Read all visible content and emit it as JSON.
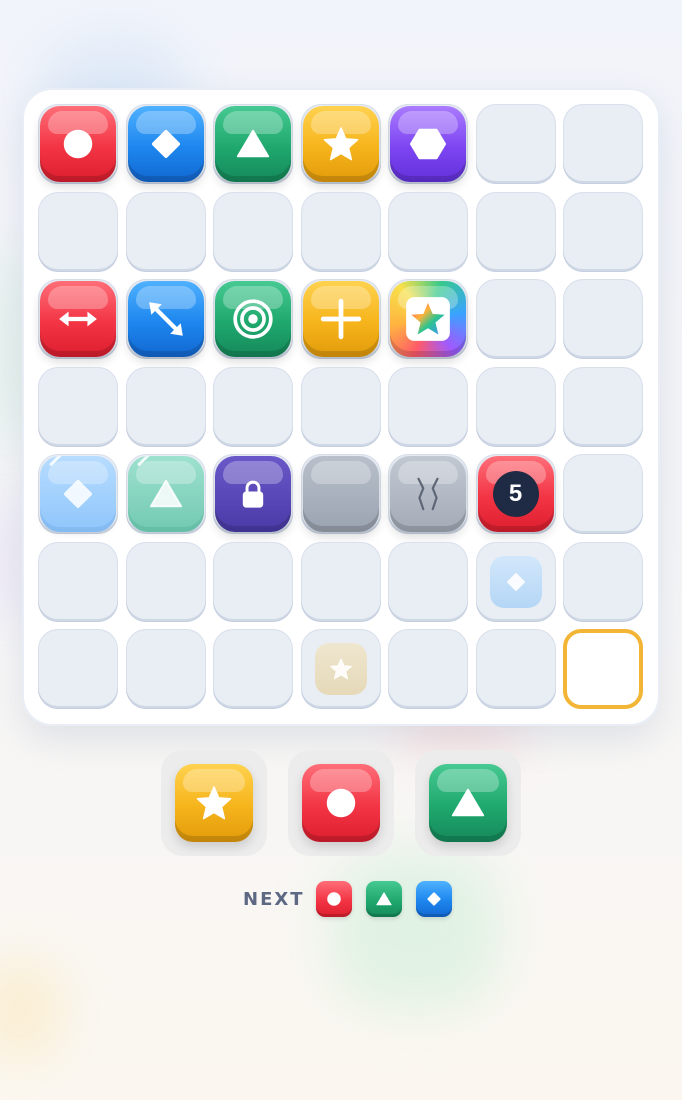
{
  "palette": {
    "red": "#f23444",
    "blue": "#1d86ee",
    "green": "#1fa86e",
    "yellow": "#f6b41b",
    "purple": "#7c45f1",
    "target_outline": "#f2b535"
  },
  "board": {
    "rows": 7,
    "cols": 7,
    "tiles": [
      {
        "row": 0,
        "col": 0,
        "kind": "gem",
        "color": "red",
        "icon": "circle-icon"
      },
      {
        "row": 0,
        "col": 1,
        "kind": "gem",
        "color": "blue",
        "icon": "diamond-icon"
      },
      {
        "row": 0,
        "col": 2,
        "kind": "gem",
        "color": "green",
        "icon": "triangle-icon"
      },
      {
        "row": 0,
        "col": 3,
        "kind": "gem",
        "color": "yellow",
        "icon": "star-icon"
      },
      {
        "row": 0,
        "col": 4,
        "kind": "gem",
        "color": "purple",
        "icon": "hexagon-icon"
      },
      {
        "row": 2,
        "col": 0,
        "kind": "powerup",
        "color": "red",
        "icon": "horizontal-arrows-icon"
      },
      {
        "row": 2,
        "col": 1,
        "kind": "powerup",
        "color": "blue",
        "icon": "diagonal-arrows-icon"
      },
      {
        "row": 2,
        "col": 2,
        "kind": "powerup",
        "color": "green",
        "icon": "target-rings-icon"
      },
      {
        "row": 2,
        "col": 3,
        "kind": "powerup",
        "color": "yellow",
        "icon": "plus-cross-icon"
      },
      {
        "row": 2,
        "col": 4,
        "kind": "powerup",
        "color": "rainbow",
        "icon": "rainbow-star-icon"
      },
      {
        "row": 4,
        "col": 0,
        "kind": "ice",
        "color": "blue",
        "icon": "diamond-icon"
      },
      {
        "row": 4,
        "col": 1,
        "kind": "ice",
        "color": "green",
        "icon": "triangle-icon"
      },
      {
        "row": 4,
        "col": 2,
        "kind": "locked",
        "color": "purple",
        "icon": "padlock-icon"
      },
      {
        "row": 4,
        "col": 3,
        "kind": "stone",
        "color": "gray",
        "icon": "none"
      },
      {
        "row": 4,
        "col": 4,
        "kind": "cracked-stone",
        "color": "gray",
        "icon": "crack-icon"
      },
      {
        "row": 4,
        "col": 5,
        "kind": "bomb-counter",
        "color": "red",
        "counter": "5"
      },
      {
        "row": 5,
        "col": 5,
        "kind": "ghost",
        "color": "blue",
        "icon": "diamond-icon"
      },
      {
        "row": 6,
        "col": 3,
        "kind": "ghost",
        "color": "yellow",
        "icon": "star-icon"
      },
      {
        "row": 6,
        "col": 6,
        "kind": "target-outline",
        "color": "yellow"
      }
    ]
  },
  "tray": [
    {
      "color": "yellow",
      "icon": "star-icon"
    },
    {
      "color": "red",
      "icon": "circle-icon"
    },
    {
      "color": "green",
      "icon": "triangle-icon"
    }
  ],
  "next": {
    "label": "NEXT",
    "pieces": [
      {
        "color": "red",
        "icon": "circle-icon"
      },
      {
        "color": "green",
        "icon": "triangle-icon"
      },
      {
        "color": "blue",
        "icon": "diamond-icon"
      }
    ]
  }
}
